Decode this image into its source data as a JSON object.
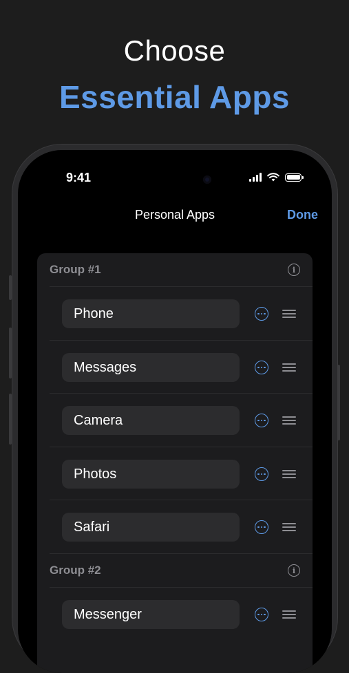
{
  "promo": {
    "line1": "Choose",
    "line2": "Essential Apps"
  },
  "status_bar": {
    "time": "9:41",
    "icons": [
      "signal-icon",
      "wifi-icon",
      "battery-icon"
    ]
  },
  "nav": {
    "title": "Personal Apps",
    "done_label": "Done"
  },
  "groups": [
    {
      "title": "Group #1",
      "apps": [
        "Phone",
        "Messages",
        "Camera",
        "Photos",
        "Safari"
      ]
    },
    {
      "title": "Group #2",
      "apps": [
        "Messenger"
      ]
    }
  ],
  "colors": {
    "accent": "#5e9ae6",
    "background": "#1d1d1d",
    "card": "#1c1c1e",
    "pill": "#2c2c2e",
    "secondary_text": "#8e8e93"
  }
}
